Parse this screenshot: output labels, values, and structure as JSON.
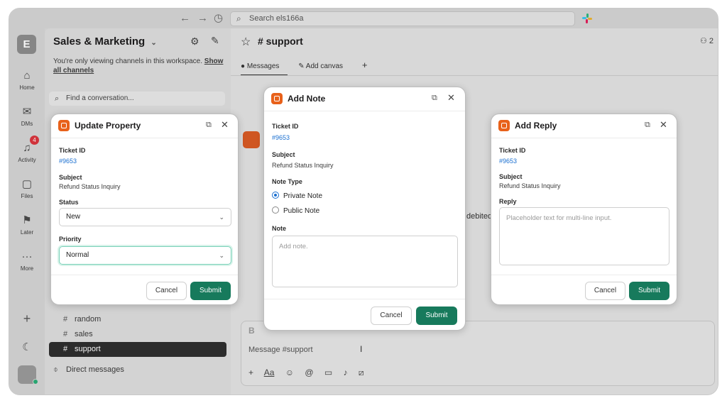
{
  "topbar": {
    "back": "←",
    "forward": "→",
    "history": "◷",
    "search_placeholder": "Search els166a"
  },
  "rail": {
    "workspace_initial": "E",
    "items": [
      {
        "label": "Home",
        "icon": "⌂"
      },
      {
        "label": "DMs",
        "icon": "✉"
      },
      {
        "label": "Activity",
        "icon": "♫",
        "badge": "4"
      },
      {
        "label": "Files",
        "icon": "▢"
      },
      {
        "label": "Later",
        "icon": "⚑"
      },
      {
        "label": "More",
        "icon": "···"
      }
    ],
    "add": "+",
    "moon": "☾"
  },
  "sidebar": {
    "workspace_name": "Sales & Marketing",
    "note": "You're only viewing channels in this workspace.",
    "note_link": "Show all channels",
    "find_placeholder": "Find a conversation...",
    "channels": [
      {
        "name": "random",
        "selected": false
      },
      {
        "name": "sales",
        "selected": false
      },
      {
        "name": "support",
        "selected": true
      }
    ],
    "direct_messages": "Direct messages"
  },
  "main": {
    "channel_title": "# support",
    "members_count": "2",
    "tabs": [
      {
        "label": "Messages"
      },
      {
        "label": "Add canvas"
      }
    ],
    "message_peek": "debited",
    "composer_placeholder": "Message #support"
  },
  "update_property": {
    "title": "Update Property",
    "ticket_id_label": "Ticket ID",
    "ticket_id": "#9653",
    "subject_label": "Subject",
    "subject": "Refund Status Inquiry",
    "status_label": "Status",
    "status_value": "New",
    "priority_label": "Priority",
    "priority_value": "Normal",
    "cancel": "Cancel",
    "submit": "Submit"
  },
  "add_note": {
    "title": "Add Note",
    "ticket_id_label": "Ticket ID",
    "ticket_id": "#9653",
    "subject_label": "Subject",
    "subject": "Refund Status Inquiry",
    "note_type_label": "Note Type",
    "options": [
      {
        "label": "Private Note",
        "selected": true
      },
      {
        "label": "Public Note",
        "selected": false
      }
    ],
    "note_label": "Note",
    "note_placeholder": "Add note.",
    "cancel": "Cancel",
    "submit": "Submit"
  },
  "add_reply": {
    "title": "Add Reply",
    "ticket_id_label": "Ticket ID",
    "ticket_id": "#9653",
    "subject_label": "Subject",
    "subject": "Refund Status Inquiry",
    "reply_label": "Reply",
    "reply_placeholder": "Placeholder text for multi-line input.",
    "cancel": "Cancel",
    "submit": "Submit"
  },
  "colors": {
    "submit": "#177a5c",
    "link": "#1a6fd0",
    "brand": "#e8611a"
  }
}
